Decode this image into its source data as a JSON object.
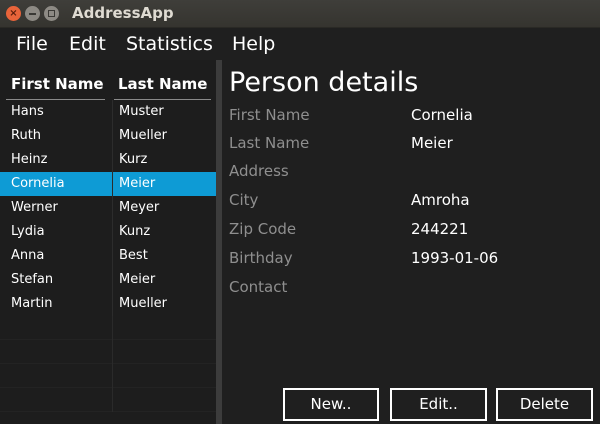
{
  "window": {
    "title": "AddressApp"
  },
  "menu": [
    "File",
    "Edit",
    "Statistics",
    "Help"
  ],
  "table": {
    "headers": [
      "First Name",
      "Last Name"
    ],
    "rows": [
      [
        "Hans",
        "Muster"
      ],
      [
        "Ruth",
        "Mueller"
      ],
      [
        "Heinz",
        "Kurz"
      ],
      [
        "Cornelia",
        "Meier"
      ],
      [
        "Werner",
        "Meyer"
      ],
      [
        "Lydia",
        "Kunz"
      ],
      [
        "Anna",
        "Best"
      ],
      [
        "Stefan",
        "Meier"
      ],
      [
        "Martin",
        "Mueller"
      ]
    ],
    "selected_index": 3
  },
  "details": {
    "title": "Person details",
    "fields": [
      {
        "label": "First Name",
        "value": "Cornelia"
      },
      {
        "label": "Last Name",
        "value": "Meier"
      },
      {
        "label": "Address",
        "value": ""
      },
      {
        "label": "City",
        "value": "Amroha"
      },
      {
        "label": "Zip Code",
        "value": "244221"
      },
      {
        "label": "Birthday",
        "value": "1993-01-06"
      },
      {
        "label": "Contact",
        "value": ""
      }
    ],
    "buttons": {
      "new": "New..",
      "edit": "Edit..",
      "delete": "Delete"
    }
  }
}
